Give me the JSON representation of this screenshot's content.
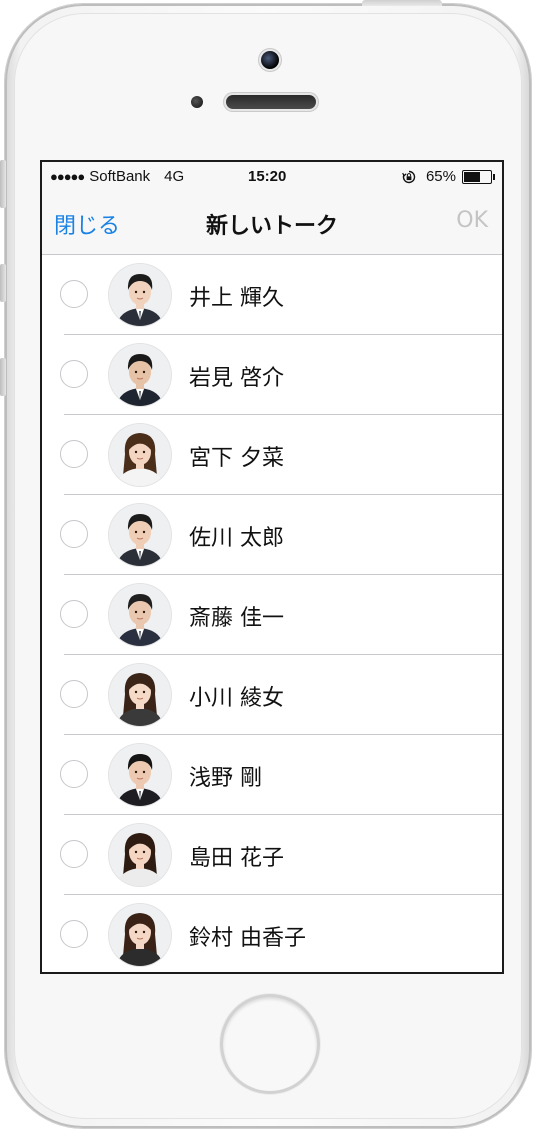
{
  "status_bar": {
    "signal_dots": "●●●●●",
    "carrier": "SoftBank",
    "network": "4G",
    "time": "15:20",
    "battery_text": "65%",
    "battery_level": 0.65
  },
  "nav": {
    "close_label": "閉じる",
    "title": "新しいトーク",
    "ok_label": "OK"
  },
  "contacts": [
    {
      "name": "井上 輝久",
      "hair": "#1c1c1c",
      "suit": "#2a2f3a",
      "skin": "#f1d3bd",
      "gender": "m"
    },
    {
      "name": "岩見 啓介",
      "hair": "#1a1a1a",
      "suit": "#1f2530",
      "skin": "#e6c2a6",
      "gender": "m"
    },
    {
      "name": "宮下 夕菜",
      "hair": "#4a2e1a",
      "suit": "#f4f4f4",
      "skin": "#f3d5c2",
      "gender": "f"
    },
    {
      "name": "佐川 太郎",
      "hair": "#1c1c1c",
      "suit": "#2b2f38",
      "skin": "#f0cdb5",
      "gender": "m"
    },
    {
      "name": "斎藤 佳一",
      "hair": "#202020",
      "suit": "#2a3040",
      "skin": "#eac8b0",
      "gender": "m"
    },
    {
      "name": "小川 綾女",
      "hair": "#3a2418",
      "suit": "#3a3a3a",
      "skin": "#f5dac8",
      "gender": "f"
    },
    {
      "name": "浅野 剛",
      "hair": "#151515",
      "suit": "#1e1e22",
      "skin": "#ecc9b0",
      "gender": "m"
    },
    {
      "name": "島田 花子",
      "hair": "#2e1c12",
      "suit": "#ececec",
      "skin": "#f4d6c3",
      "gender": "f"
    },
    {
      "name": "鈴村 由香子",
      "hair": "#3b2216",
      "suit": "#2c2c2c",
      "skin": "#f4d7c4",
      "gender": "f"
    }
  ],
  "colors": {
    "accent": "#1a82e5",
    "disabled": "#c4c4c4",
    "separator": "#c8c7cc"
  }
}
